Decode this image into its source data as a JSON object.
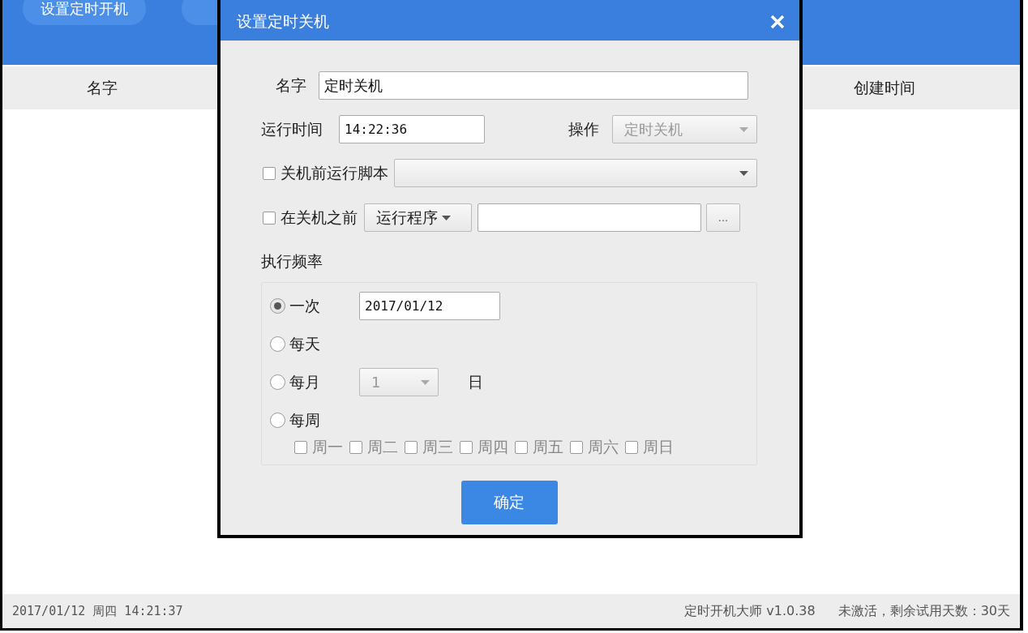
{
  "header": {
    "buttons": [
      {
        "label": "设置定时开机"
      },
      {
        "kind": "covered"
      }
    ]
  },
  "table": {
    "columns": [
      {
        "label": "名字"
      },
      {
        "label": "创建时间"
      }
    ]
  },
  "status_bar": {
    "datetime": "2017/01/12 周四 14:21:37",
    "app": "定时开机大师 v1.0.38",
    "license": "未激活，剩余试用天数：30天"
  },
  "dialog": {
    "title": "设置定时关机",
    "name": {
      "label": "名字",
      "value": "定时关机"
    },
    "run_time": {
      "label": "运行时间",
      "value": "14:22:36"
    },
    "operation": {
      "label": "操作",
      "value": "定时关机",
      "disabled": true
    },
    "script": {
      "label": "关机前运行脚本",
      "checked": false
    },
    "before": {
      "label": "在关机之前",
      "checked": false,
      "action": "运行程序",
      "browse": "..."
    },
    "frequency": {
      "label": "执行频率",
      "options": [
        {
          "label": "一次",
          "selected": true,
          "kind": "date",
          "value": "2017/01/12"
        },
        {
          "label": "每天",
          "selected": false,
          "kind": "plain"
        },
        {
          "label": "每月",
          "selected": false,
          "kind": "day",
          "value": "1",
          "suffix": "日",
          "disabled": true
        },
        {
          "label": "每周",
          "selected": false,
          "kind": "plain"
        }
      ],
      "weekdays": [
        {
          "label": "周一",
          "checked": false,
          "disabled": true
        },
        {
          "label": "周二",
          "checked": false,
          "disabled": true
        },
        {
          "label": "周三",
          "checked": false,
          "disabled": true
        },
        {
          "label": "周四",
          "checked": false,
          "disabled": true
        },
        {
          "label": "周五",
          "checked": false,
          "disabled": true
        },
        {
          "label": "周六",
          "checked": false,
          "disabled": true
        },
        {
          "label": "周日",
          "checked": false,
          "disabled": true
        }
      ]
    },
    "confirm": "确定"
  }
}
